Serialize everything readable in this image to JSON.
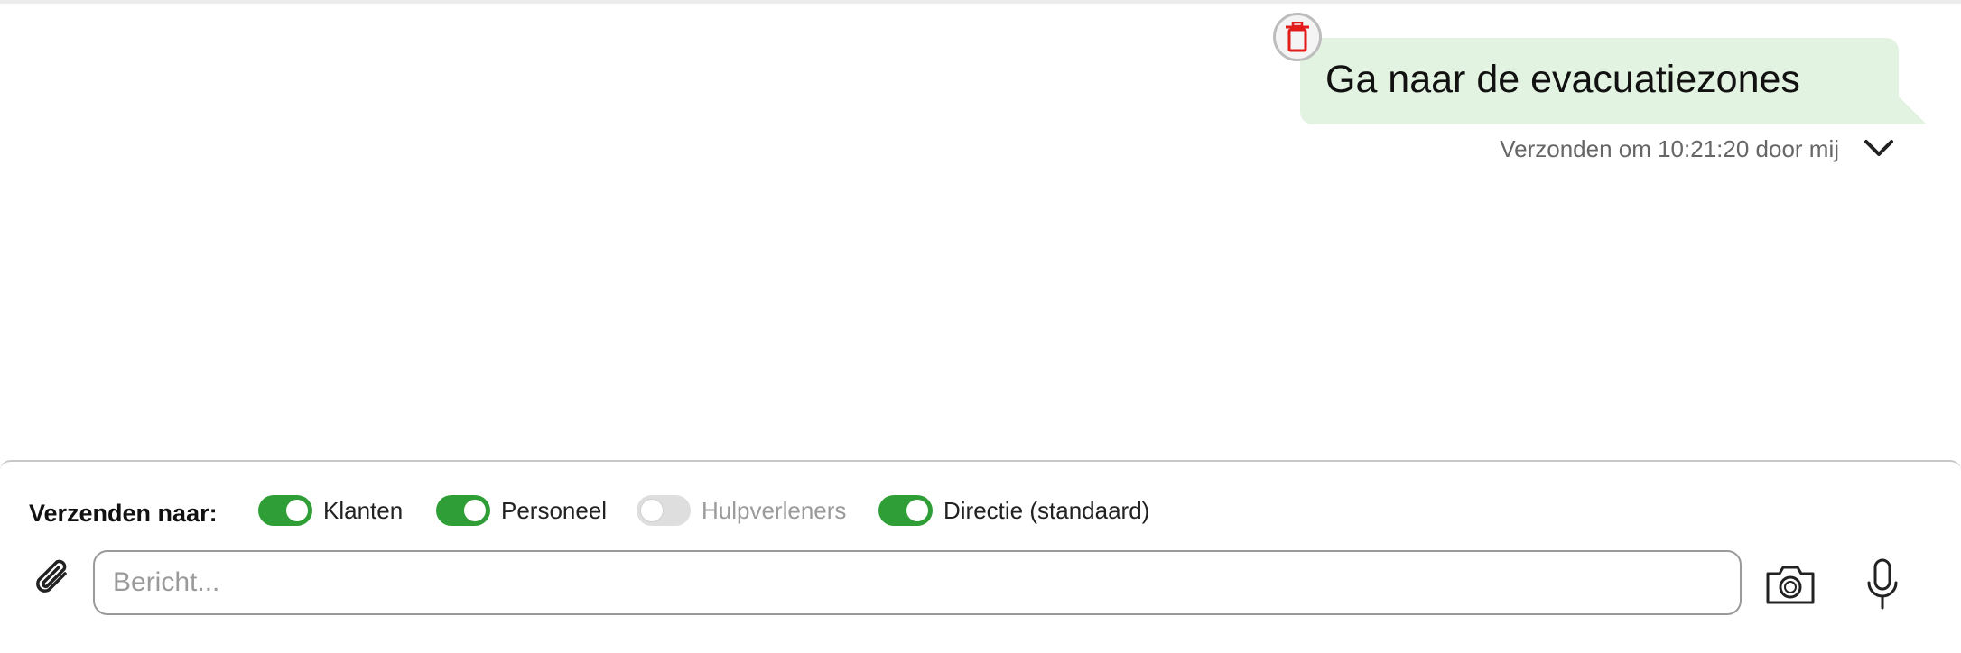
{
  "message": {
    "text": "Ga naar de evacuatiezones",
    "meta": "Verzonden om 10:21:20 door mij",
    "delete_icon": "trash-icon",
    "expand_icon": "chevron-down-icon",
    "bubble_color": "#e3f3e1"
  },
  "composer": {
    "send_to_label": "Verzenden naar:",
    "recipients": [
      {
        "label": "Klanten",
        "enabled": true
      },
      {
        "label": "Personeel",
        "enabled": true
      },
      {
        "label": "Hulpverleners",
        "enabled": false
      },
      {
        "label": "Directie (standaard)",
        "enabled": true
      }
    ],
    "input_placeholder": "Bericht...",
    "input_value": "",
    "attach_icon": "paperclip-icon",
    "camera_icon": "camera-icon",
    "mic_icon": "microphone-icon",
    "toggle_on_color": "#2f9e36"
  }
}
